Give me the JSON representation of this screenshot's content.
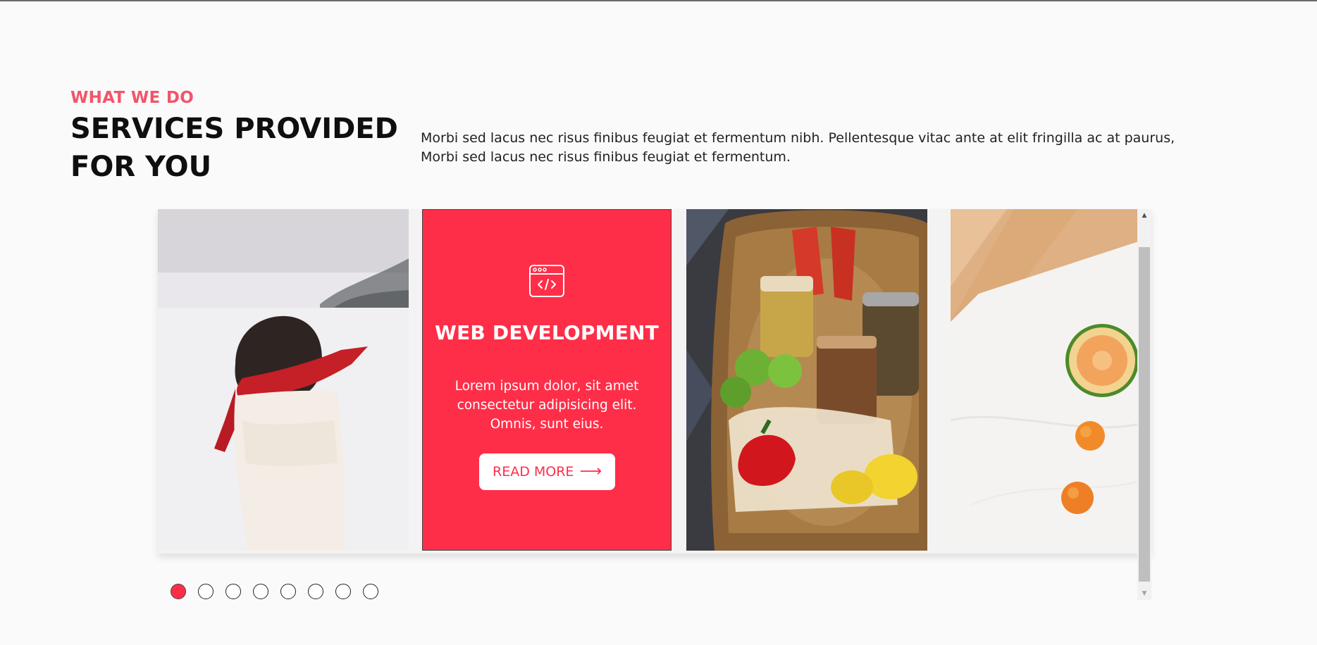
{
  "section": {
    "eyebrow": "WHAT WE DO",
    "title_line1": "SERVICES PROVIDED",
    "title_line2": "FOR YOU",
    "intro": "Morbi sed lacus nec risus finibus feugiat et fermentum nibh. Pellentesque vitac ante at elit fringilla ac at paurus, Morbi sed lacus nec risus finibus feugiat et fermentum."
  },
  "carousel": {
    "cards": [
      {
        "kind": "image",
        "subject": "woman in red scarf in snow"
      },
      {
        "kind": "service",
        "icon": "code-window-icon",
        "title": "WEB DEVELOPMENT",
        "description": "Lorem ipsum dolor, sit amet consectetur adipisicing elit. Omnis, sunt eius.",
        "button_label": "READ MORE",
        "button_icon": "arrow-right-icon"
      },
      {
        "kind": "image",
        "subject": "wicker basket with vegetables and jars"
      },
      {
        "kind": "image",
        "subject": "melon and apricots on marble table"
      }
    ],
    "page_count": 8,
    "active_page": 1
  },
  "colors": {
    "accent": "#ff2e48",
    "eyebrow": "#f2556a",
    "background": "#fafafa",
    "title": "#0f0f0f"
  }
}
